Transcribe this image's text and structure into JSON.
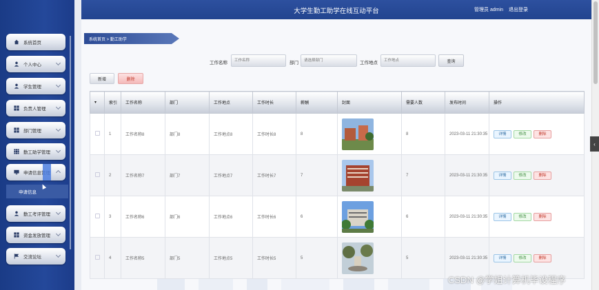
{
  "header": {
    "title": "大学生勤工助学在线互动平台",
    "user": "管理员 admin",
    "logout": "退出登录"
  },
  "sidebar": {
    "items": [
      {
        "label": "系统首页",
        "icon": "home-icon"
      },
      {
        "label": "个人中心",
        "icon": "person-icon"
      },
      {
        "label": "学生管理",
        "icon": "person-icon"
      },
      {
        "label": "负责人管理",
        "icon": "grid-icon"
      },
      {
        "label": "部门管理",
        "icon": "grid-icon"
      },
      {
        "label": "勤工助学管理",
        "icon": "grid-icon"
      },
      {
        "label": "申请信息管理",
        "icon": "monitor-icon"
      },
      {
        "label": "勤工考评管理",
        "icon": "person-icon"
      },
      {
        "label": "资金发放管理",
        "icon": "grid-icon"
      },
      {
        "label": "交流论坛",
        "icon": "flag-icon"
      }
    ],
    "submenu": "申请信息"
  },
  "breadcrumb": "系统首页 > 勤工助学",
  "filters": {
    "name_label": "工作名称",
    "name_placeholder": "工作名称",
    "dept_label": "部门",
    "dept_placeholder": "请选择部门",
    "place_label": "工作地点",
    "place_placeholder": "工作地点",
    "query": "查询"
  },
  "actions": {
    "add": "新增",
    "delete": "删除"
  },
  "table": {
    "headers": [
      "",
      "索引",
      "工作名称",
      "部门",
      "工作地点",
      "工作时长",
      "薪酬",
      "封面",
      "需要人数",
      "发布时间",
      "操作"
    ],
    "rows": [
      {
        "idx": "1",
        "name": "工作名称8",
        "dept": "部门8",
        "place": "工作地点8",
        "hours": "工作时长8",
        "pay": "8",
        "need": "8",
        "time": "2023-03-11 21:30:35"
      },
      {
        "idx": "2",
        "name": "工作名称7",
        "dept": "部门7",
        "place": "工作地点7",
        "hours": "工作时长7",
        "pay": "7",
        "need": "7",
        "time": "2023-03-11 21:30:35"
      },
      {
        "idx": "3",
        "name": "工作名称6",
        "dept": "部门6",
        "place": "工作地点6",
        "hours": "工作时长6",
        "pay": "6",
        "need": "6",
        "time": "2023-03-11 21:30:35"
      },
      {
        "idx": "4",
        "name": "工作名称5",
        "dept": "部门5",
        "place": "工作地点5",
        "hours": "工作时长5",
        "pay": "5",
        "need": "5",
        "time": "2023-03-11 21:30:35"
      }
    ],
    "op_detail": "详情",
    "op_edit": "修改",
    "op_delete": "删除"
  },
  "watermark": "CSDN @学姐计算机毕设程序"
}
